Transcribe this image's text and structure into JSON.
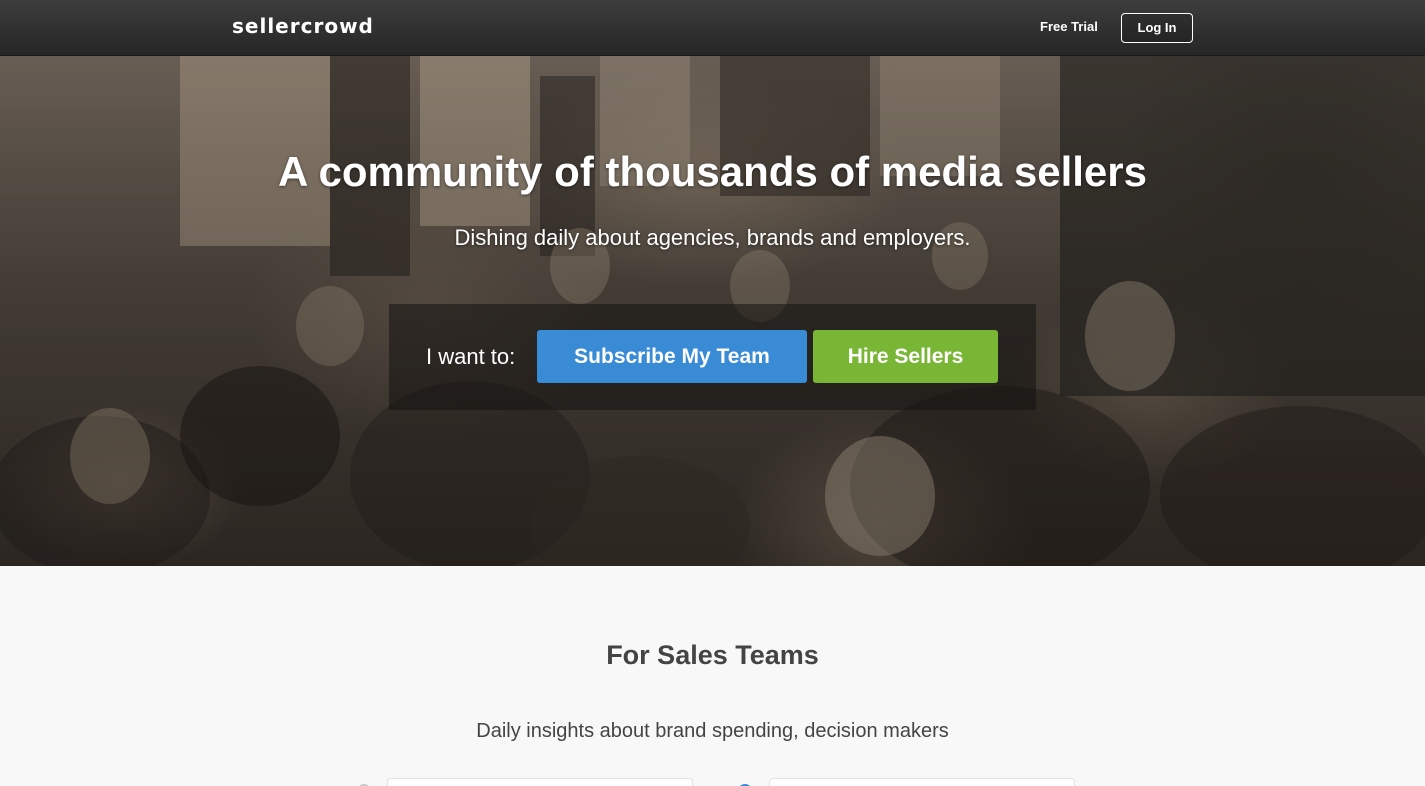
{
  "nav": {
    "logo": "sellercrowd",
    "free_trial": "Free Trial",
    "login": "Log In"
  },
  "hero": {
    "title": "A community of thousands of media sellers",
    "subtitle": "Dishing daily about agencies, brands and employers.",
    "cta_label": "I want to:",
    "subscribe_button": "Subscribe My Team",
    "hire_button": "Hire Sellers"
  },
  "sales_section": {
    "title": "For Sales Teams",
    "description": "Daily insights about brand spending, decision makers"
  },
  "colors": {
    "nav_bg": "#2f2f2f",
    "primary_blue": "#3a8bd6",
    "primary_green": "#7ab636",
    "page_bg": "#f8f8f8",
    "heading_text": "#444444"
  }
}
